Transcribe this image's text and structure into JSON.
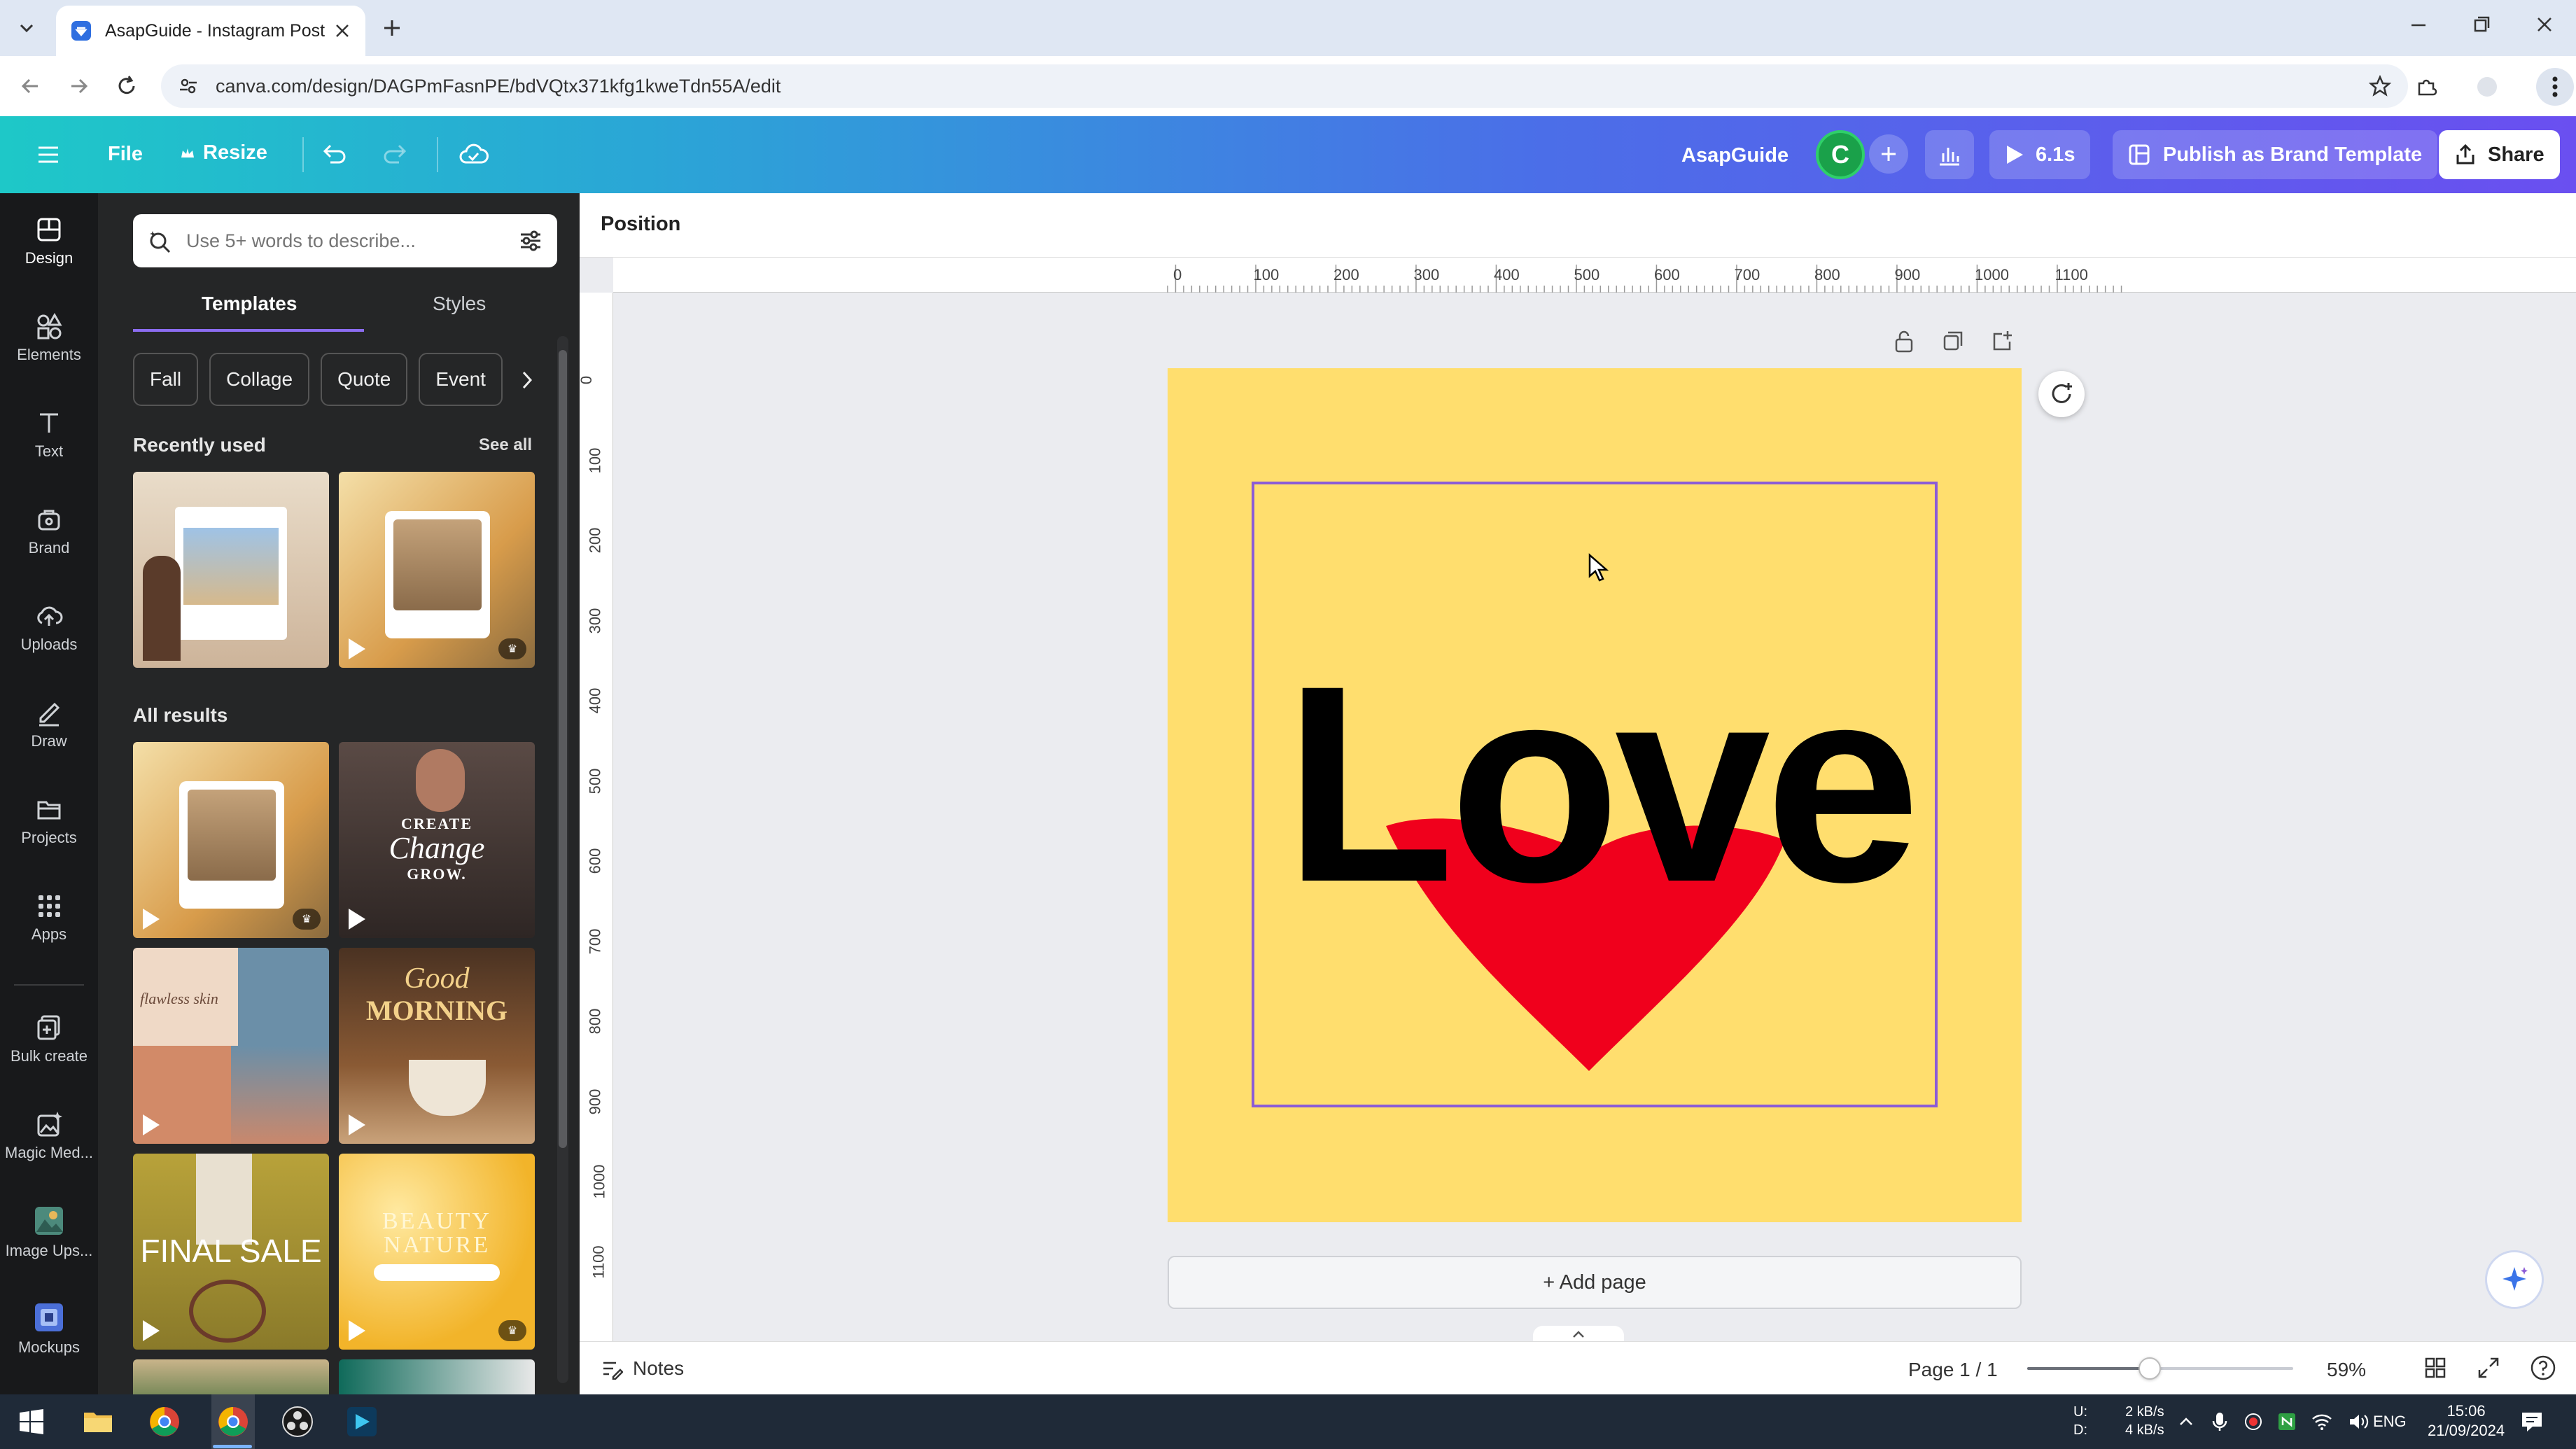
{
  "browser": {
    "tab_title": "AsapGuide - Instagram Post",
    "url": "canva.com/design/DAGPmFasnPE/bdVQtx371kfg1kweTdn55A/edit"
  },
  "header": {
    "file": "File",
    "resize": "Resize",
    "brand_name": "AsapGuide",
    "avatar_letter": "C",
    "play_time": "6.1s",
    "publish": "Publish as Brand Template",
    "share": "Share"
  },
  "rail": {
    "items": [
      {
        "label": "Design",
        "icon": "design-icon"
      },
      {
        "label": "Elements",
        "icon": "elements-icon"
      },
      {
        "label": "Text",
        "icon": "text-icon"
      },
      {
        "label": "Brand",
        "icon": "brand-icon"
      },
      {
        "label": "Uploads",
        "icon": "uploads-icon"
      },
      {
        "label": "Draw",
        "icon": "draw-icon"
      },
      {
        "label": "Projects",
        "icon": "projects-icon"
      },
      {
        "label": "Apps",
        "icon": "apps-icon"
      },
      {
        "label": "Bulk create",
        "icon": "bulk-create-icon"
      },
      {
        "label": "Magic Med...",
        "icon": "magic-media-icon"
      },
      {
        "label": "Image Ups...",
        "icon": "image-upscaler-icon"
      },
      {
        "label": "Mockups",
        "icon": "mockups-icon"
      }
    ]
  },
  "panel": {
    "search_placeholder": "Use 5+ words to describe...",
    "tabs": [
      "Templates",
      "Styles"
    ],
    "chips": [
      "Fall",
      "Collage",
      "Quote",
      "Event"
    ],
    "recently_used": "Recently used",
    "see_all": "See all",
    "all_results": "All results",
    "thumb_texts": {
      "create": "CREATE",
      "change": "Change",
      "grow": "GROW.",
      "flawless": "flawless skin",
      "good": "Good",
      "morning": "MORNING",
      "final_sale": "FINAL SALE",
      "beauty": "BEAUTY",
      "nature": "NATURE"
    }
  },
  "editor": {
    "position": "Position",
    "hruler": [
      "0",
      "100",
      "200",
      "300",
      "400",
      "500",
      "600",
      "700",
      "800",
      "900",
      "1000",
      "1100"
    ],
    "vruler": [
      "0",
      "100",
      "200",
      "300",
      "400",
      "500",
      "600",
      "700",
      "800",
      "900",
      "1000",
      "1100"
    ],
    "canvas_text": "Love",
    "add_page": "+ Add page",
    "colors": {
      "page_bg": "#ffde6e",
      "heart": "#f0001c",
      "selection": "#8b5bd6"
    }
  },
  "bottom": {
    "notes": "Notes",
    "page_count": "Page 1 / 1",
    "zoom": "59%",
    "zoom_level": 0.46
  },
  "taskbar": {
    "net_up_label": "U:",
    "net_down_label": "D:",
    "net_up": "2 kB/s",
    "net_down": "4 kB/s",
    "lang": "ENG",
    "time": "15:06",
    "date": "21/09/2024"
  }
}
